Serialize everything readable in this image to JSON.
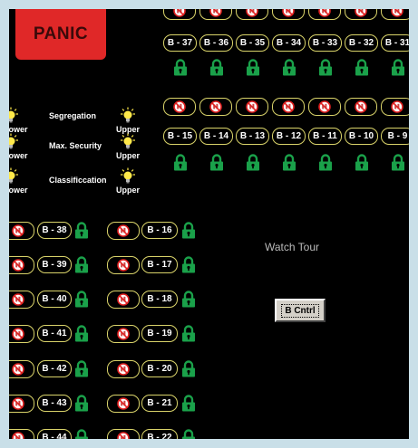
{
  "panic_label": "PANIC",
  "watch_tour_label": "Watch Tour",
  "b_cntrl_label": "B Cntrl",
  "colors": {
    "background": "#000000",
    "panic": "#e02828",
    "pill_border": "#d9d36a",
    "lock": "#1aa14a",
    "prohibit": "#e02020",
    "bulb": "#ffe94a"
  },
  "controls": [
    {
      "name": "Segregation",
      "lower": "Lower",
      "upper": "Upper"
    },
    {
      "name": "Max. Security",
      "lower": "Lower",
      "upper": "Upper"
    },
    {
      "name": "Classificcation",
      "lower": "Lower",
      "upper": "Upper"
    }
  ],
  "top_row_1": [
    "B - 37",
    "B - 36",
    "B - 35",
    "B - 34",
    "B - 33",
    "B - 32",
    "B - 31"
  ],
  "top_row_2": [
    "B - 15",
    "B - 14",
    "B - 13",
    "B - 12",
    "B - 11",
    "B - 10",
    "B - 9"
  ],
  "left_col_1": [
    "B - 38",
    "B - 39",
    "B - 40",
    "B - 41",
    "B - 42",
    "B - 43",
    "B - 44"
  ],
  "left_col_2": [
    "B - 16",
    "B - 17",
    "B - 18",
    "B - 19",
    "B - 20",
    "B - 21",
    "B - 22"
  ]
}
